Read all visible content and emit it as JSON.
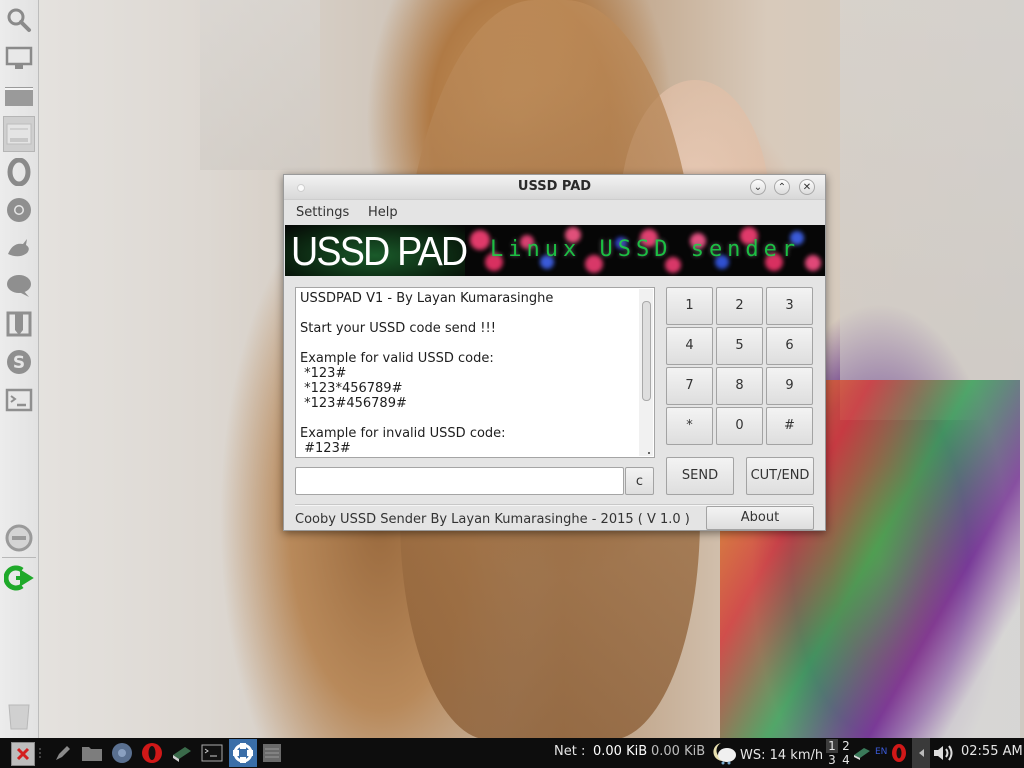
{
  "window": {
    "title": "USSD PAD",
    "controls": {
      "minimize": "⌄",
      "maximize": "⌃",
      "close": "✕"
    },
    "menu": [
      {
        "label": "Settings"
      },
      {
        "label": "Help"
      }
    ],
    "banner": {
      "title": "USSD PAD",
      "subtitle": "Linux USSD sender"
    },
    "text_area": {
      "content": "USSDPAD V1 - By Layan Kumarasinghe\n\nStart your USSD code send !!!\n\nExample for valid USSD code:\n *123#\n *123*456789#\n *123#456789#\n\nExample for invalid USSD code:\n #123#"
    },
    "input": {
      "value": "",
      "placeholder": ""
    },
    "clear_button": "c",
    "keypad": [
      "1",
      "2",
      "3",
      "4",
      "5",
      "6",
      "7",
      "8",
      "9",
      "*",
      "0",
      "#"
    ],
    "send_button": "SEND",
    "end_button": "CUT/END",
    "about_button": "About",
    "status_text": "Cooby USSD Sender By Layan Kumarasinghe - 2015 ( V 1.0 )"
  },
  "dock": {
    "items": [
      {
        "icon": "search-icon"
      },
      {
        "icon": "monitor-icon"
      },
      {
        "icon": "folder-icon"
      },
      {
        "icon": "window-app-icon",
        "active": true
      },
      {
        "icon": "opera-icon"
      },
      {
        "icon": "chrome-icon"
      },
      {
        "icon": "bird-icon"
      },
      {
        "icon": "chat-bubble-icon"
      },
      {
        "icon": "book-icon"
      },
      {
        "icon": "skype-icon"
      },
      {
        "icon": "terminal-icon"
      }
    ],
    "bottom": [
      {
        "icon": "minus-circle-icon"
      },
      {
        "icon": "logout-icon",
        "color": "#1fa92a"
      },
      {
        "icon": "trash-icon"
      }
    ]
  },
  "taskbar": {
    "launchers": [
      {
        "icon": "close-app-icon",
        "color": "#d42020"
      },
      {
        "icon": "pen-icon"
      },
      {
        "icon": "folder-icon"
      },
      {
        "icon": "chrome-icon"
      },
      {
        "icon": "opera-icon",
        "color": "#d01818"
      },
      {
        "icon": "book-icon"
      },
      {
        "icon": "terminal-icon"
      },
      {
        "icon": "network-app-icon",
        "active": true
      },
      {
        "icon": "list-app-icon"
      }
    ],
    "net_label": "Net :",
    "net_down": "0.00 KiB",
    "net_up": "0.00 KiB",
    "weather": "WS: 14 km/h",
    "workspaces": [
      "1",
      "2",
      "3",
      "4"
    ],
    "active_workspace": "1",
    "keyboard_layout": "EN",
    "clock": "02:55 AM"
  }
}
